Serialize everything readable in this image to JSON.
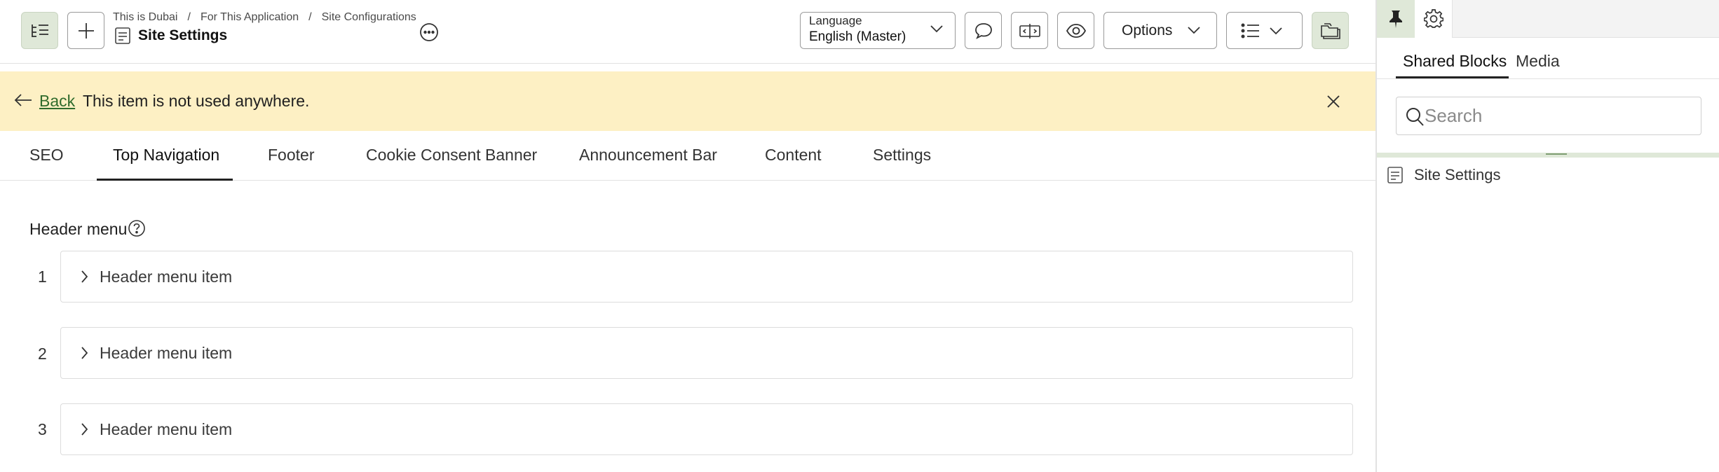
{
  "breadcrumbs": [
    "This is Dubai",
    "For This Application",
    "Site Configurations"
  ],
  "breadcrumb_separator": "/",
  "page_title": "Site Settings",
  "language": {
    "label": "Language",
    "value": "English (Master)"
  },
  "toolbar": {
    "options_label": "Options"
  },
  "notice": {
    "back_label": "Back",
    "message": "This item is not used anywhere."
  },
  "tabs": [
    {
      "label": "SEO"
    },
    {
      "label": "Top Navigation",
      "active": true
    },
    {
      "label": "Footer"
    },
    {
      "label": "Cookie Consent Banner"
    },
    {
      "label": "Announcement Bar"
    },
    {
      "label": "Content"
    },
    {
      "label": "Settings"
    }
  ],
  "section": {
    "label": "Header menu",
    "items": [
      {
        "index": "1",
        "label": "Header menu item"
      },
      {
        "index": "2",
        "label": "Header menu item"
      },
      {
        "index": "3",
        "label": "Header menu item"
      }
    ]
  },
  "sidepane": {
    "tabs": [
      {
        "label": "Shared Blocks",
        "active": true
      },
      {
        "label": "Media"
      }
    ],
    "search_placeholder": "Search",
    "tree_item": "Site Settings"
  },
  "colors": {
    "accent_green": "#dfe8d8",
    "notice_bg": "#fdf0c4",
    "link_green": "#2f6b2c"
  }
}
